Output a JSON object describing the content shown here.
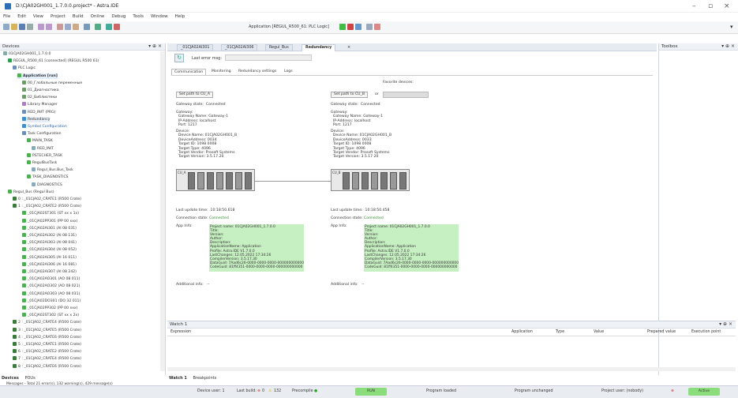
{
  "window": {
    "title": "D:\\CJA02GH001_1.7.0.0.project* - Astra.IDE"
  },
  "menu": [
    "File",
    "Edit",
    "View",
    "Project",
    "Build",
    "Online",
    "Debug",
    "Tools",
    "Window",
    "Help"
  ],
  "toolbar": {
    "application": "Application [REGUL_R500_61: PLC Logic]"
  },
  "devices_panel": {
    "title": "Devices",
    "tree": [
      "01CJA02GH001_1.7.0.0",
      "REGUL_R500_61 [connected] (REGUL R500 61)",
      "PLC Logic",
      "Application [run]",
      "00_Глобальные переменные",
      "01_Диагностика",
      "02_Библиотеки",
      "Library Manager",
      "RED_INIT (PRG)",
      "Redundancy",
      "Symbol Configuration",
      "Task Configuration",
      "MAIN_TASK",
      "RED_INIT",
      "PSTECHER_TASK",
      "RegulBusTask",
      "Regul_Bus.Bus_Task",
      "TASK_DIAGNOSTICS",
      "DIAGNOSTICS",
      "Regul_Bus (Regul Bus)",
      "0 : _01CJA02_CRATE1 (R500 Crate)",
      "1 : _01CJA02_CRATE2 (R500 Crate)",
      "_01CJA02ST301 (ST xx x 1x)",
      "_01CJA02PP301 (PP 00 xxx)",
      "_01CJA02AI301 (AI 08 031)",
      "_01CJA02AI302 (AI 08 131)",
      "_01CJA02AI303 (AI 08 041)",
      "_01CJA02AI304 (AI 08 052)",
      "_01CJA02AI305 (AI 16 011)",
      "_01CJA02AI306 (AI 16 081)",
      "_01CJA02AI307 (AI 08 242)",
      "_01CJA02AO301 (AO 08 011)",
      "_01CJA02AO302 (AO 08 021)",
      "_01CJA02AO303 (AO 08 031)",
      "_01CJA02DO301 (DO 32 011)",
      "_01CJA02PP302 (PP 00 xxx)",
      "_01CJA02ST302 (ST xx x 2x)",
      "2 : _01CJA02_CRATE4 (R500 Crate)",
      "3 : _01CJA02_CRATE5 (R500 Crate)",
      "4 : _01CJA02_CRATE6 (R500 Crate)",
      "5 : _01CJA02_CRATE1 (R500 Crate)",
      "6 : _01CJA02_CRATE2 (R500 Crate)",
      "7 : _01CJA02_CRATE4 (R500 Crate)",
      "8 : _01CJA02_CRATE6 (R500 Crate)"
    ],
    "bottom_tabs": [
      "Devices",
      "POUs"
    ]
  },
  "editor": {
    "tabs": [
      "_01CJA02AI301",
      "_01CJA02AI306",
      "Regul_Bus",
      "Redundancy"
    ],
    "last_error_label": "Last error msg:",
    "subtabs": [
      "Communication",
      "Monitoring",
      "Redundancy settings",
      "Logs"
    ],
    "favorite_devices_label": "Favorite devices:",
    "left": {
      "button": "Set path to CU_A",
      "gateway_state": "Gateway state:  Connected",
      "gateway_info": "Gateway:\n  Gateway Name: Gateway-1\n  IP-Address: localhost\n  Port: 1217",
      "device_info": "Device:\n  Device Name: 01CJA02GH001_B\n  DeviceAddress: 0034\n  Target ID: 1098 0008\n  Target Type: 4096\n  Target Vendor: Prosoft Systems\n  Target Version: 3.5.17.20",
      "rack_label": "CU_A",
      "last_update": "Last update time:  10:18:50.618",
      "connection_state_label": "Connection state:",
      "connection_state": "Connected",
      "app_info_label": "App Info:",
      "app_info": "Project name: 01CJA02GH001_1.7.0.0\nTitle:\nVersion:\nAuthor:\nDescription:\nApplicationName: Application\nProfile: Astra.IDE V1.7.0.0\nLastChanges: 12.05.2022 17:34:26\nCompilerVersion: 3.5.17.30\nDataGuid: 7Aad6c26-0000-0000-0000-000000000000\nCodeGuid: 81ff4351-0000-0000-0000-000000000000",
      "additional_info": "Additional info:   --"
    },
    "right": {
      "button": "Set path to CU_B",
      "or_label": "or",
      "gateway_state": "Gateway state:  Connected",
      "gateway_info": "Gateway:\n  Gateway Name: Gateway-1\n  IP-Address: localhost\n  Port: 1217",
      "device_info": "Device:\n  Device Name: 01CJA02GH001_B\n  DeviceAddress: 0033\n  Target ID: 1098 0008\n  Target Type: 4096\n  Target Vendor: Prosoft Systems\n  Target Version: 3.5.17.20",
      "rack_label": "CU_B",
      "last_update": "Last update time:  10:18:50.458",
      "connection_state_label": "Connection state:",
      "connection_state": "Connected",
      "app_info_label": "App Info:",
      "app_info": "Project name: 01CJA02GH001_1.7.0.0\nTitle:\nVersion:\nAuthor:\nDescription:\nApplicationName: Application\nProfile: Astra.IDE V1.7.0.0\nLastChanges: 12.05.2022 17:34:26\nCompilerVersion: 3.5.17.30\nDataGuid: 7Aad6c26-0000-0000-0000-000000000000\nCodeGuid: 81ff4351-0000-0000-0000-000000000000",
      "additional_info": "Additional info:   --"
    }
  },
  "watch": {
    "title": "Watch 1",
    "columns": [
      "Expression",
      "Application",
      "Type",
      "Value",
      "Prepared value",
      "Execution point"
    ],
    "bottom_tabs": [
      "Watch 1",
      "Breakpoints"
    ]
  },
  "toolbox": {
    "title": "Toolbox"
  },
  "status": {
    "messages": "Messages - Total 21 error(s), 132 warning(s), 429 message(s)",
    "device_user": "Device user: 1",
    "last_build": "Last build:",
    "errors": "0",
    "warnings": "132",
    "precompile": "Precompile",
    "run": "RUN",
    "program_loaded": "Program loaded",
    "program_unchanged": "Program unchanged",
    "project_user": "Project user: (nobody)",
    "active": "Active"
  }
}
